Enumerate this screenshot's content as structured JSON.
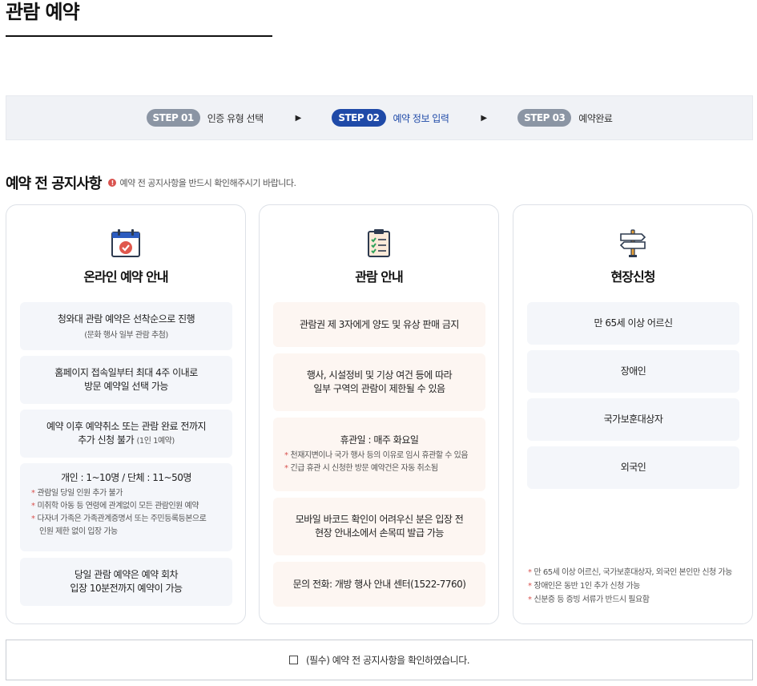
{
  "page": {
    "title": "관람 예약"
  },
  "steps": [
    {
      "badge": "STEP 01",
      "label": "인증 유형 선택"
    },
    {
      "badge": "STEP 02",
      "label": "예약 정보 입력"
    },
    {
      "badge": "STEP 03",
      "label": "예약완료"
    }
  ],
  "step_arrow": "▶",
  "notice": {
    "title": "예약 전 공지사항",
    "icon_glyph": "!",
    "note": "예약 전 공지사항을 반드시 확인해주시기 바랍니다."
  },
  "card_online": {
    "title": "온라인 예약 안내",
    "box1_main": "청와대 관람 예약은 선착순으로 진행",
    "box1_sub": "(문화 행사 일부 관람 추첨)",
    "box2_line1": "홈페이지 접속일부터 최대 4주 이내로",
    "box2_line2": "방문 예약일 선택 가능",
    "box3_line1": "예약 이후 예약취소 또는 관람 완료 전까지",
    "box3_line2": "추가 신청 불가",
    "box3_paren": "(1인 1예약)",
    "box4_main": "개인 : 1~10명 / 단체 : 11~50명",
    "box4_note1": "관람일 당일 인원 추가 불가",
    "box4_note2": "미취학 아동 등 연령에 관계없이 모든 관람인원 예약",
    "box4_note3a": "다자녀 가족은 가족관계증명서 또는 주민등록등본으로",
    "box4_note3b": "인원 제한 없이 입장 가능",
    "box5_line1": "당일 관람 예약은 예약 회차",
    "box5_line2": "입장 10분전까지 예약이 가능"
  },
  "card_visit": {
    "title": "관람 안내",
    "box1_main": "관람권 제 3자에게 양도 및 유상 판매 금지",
    "box2_line1": "행사, 시설정비 및 기상 여건 등에 따라",
    "box2_line2": "일부 구역의 관람이 제한될 수 있음",
    "box3_main": "휴관일 : 매주 화요일",
    "box3_note1": "천재지변이나 국가 행사 등의 이유로 임시 휴관할 수 있음",
    "box3_note2": "긴급 휴관 시 신청한 방문 예약건은 자동 취소됨",
    "box4_line1": "모바일 바코드 확인이 어려우신 분은 입장 전",
    "box4_line2": "현장 안내소에서 손목띠 발급 가능",
    "box5_main": "문의 전화: 개방 행사 안내 센터(1522-7760)"
  },
  "card_onsite": {
    "title": "현장신청",
    "items": [
      "만 65세 이상 어르신",
      "장애인",
      "국가보훈대상자",
      "외국인"
    ],
    "note1": "만 65세 이상 어르신, 국가보훈대상자, 외국인 본인만 신청 가능",
    "note2": "장애인은 동반 1인 추가 신청 가능",
    "note3": "신분증 등 증빙 서류가 반드시 필요함"
  },
  "note_star": "*",
  "confirm": {
    "label": "(필수) 예약 전 공지사항을 확인하였습니다."
  },
  "colors": {
    "accent": "#1f4aa8",
    "inactive_step": "#8b95a4",
    "alert": "#d9534f",
    "blue_box": "#f4f6fa",
    "peach_box": "#fdf6f2"
  },
  "icons": {
    "card_online": "calendar-check-icon",
    "card_visit": "clipboard-checklist-icon",
    "card_onsite": "signpost-icon"
  }
}
